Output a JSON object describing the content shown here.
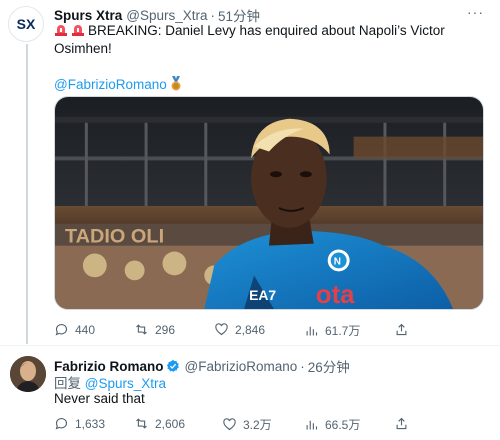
{
  "tweet1": {
    "author_name": "Spurs Xtra",
    "handle": "@Spurs_Xtra",
    "dot": "·",
    "time": "51分钟",
    "more": "···",
    "text_line": "BREAKING: Daniel Levy has enquired about Napoli’s Victor Osimhen!",
    "mention": "@FabrizioRomano",
    "avatar_text": "SX",
    "image_banner_text": "TADIO OLI",
    "stats": {
      "replies": "440",
      "retweets": "296",
      "likes": "2,846",
      "views": "61.7万"
    }
  },
  "tweet2": {
    "author_name": "Fabrizio Romano",
    "handle": "@FabrizioRomano",
    "dot": "·",
    "time": "26分钟",
    "reply_prefix": "回复",
    "reply_mention": "@Spurs_Xtra",
    "text": "Never said that",
    "stats": {
      "replies": "1,633",
      "retweets": "2,606",
      "likes": "3.2万",
      "views": "66.5万"
    }
  },
  "colors": {
    "accent": "#1d9bf0",
    "text": "#0f1419",
    "muted": "#536471",
    "verified": "#1d9bf0"
  },
  "icons": [
    "siren-icon",
    "medal-icon",
    "reply-icon",
    "retweet-icon",
    "like-icon",
    "views-icon",
    "share-icon",
    "verified-icon",
    "more-icon"
  ]
}
